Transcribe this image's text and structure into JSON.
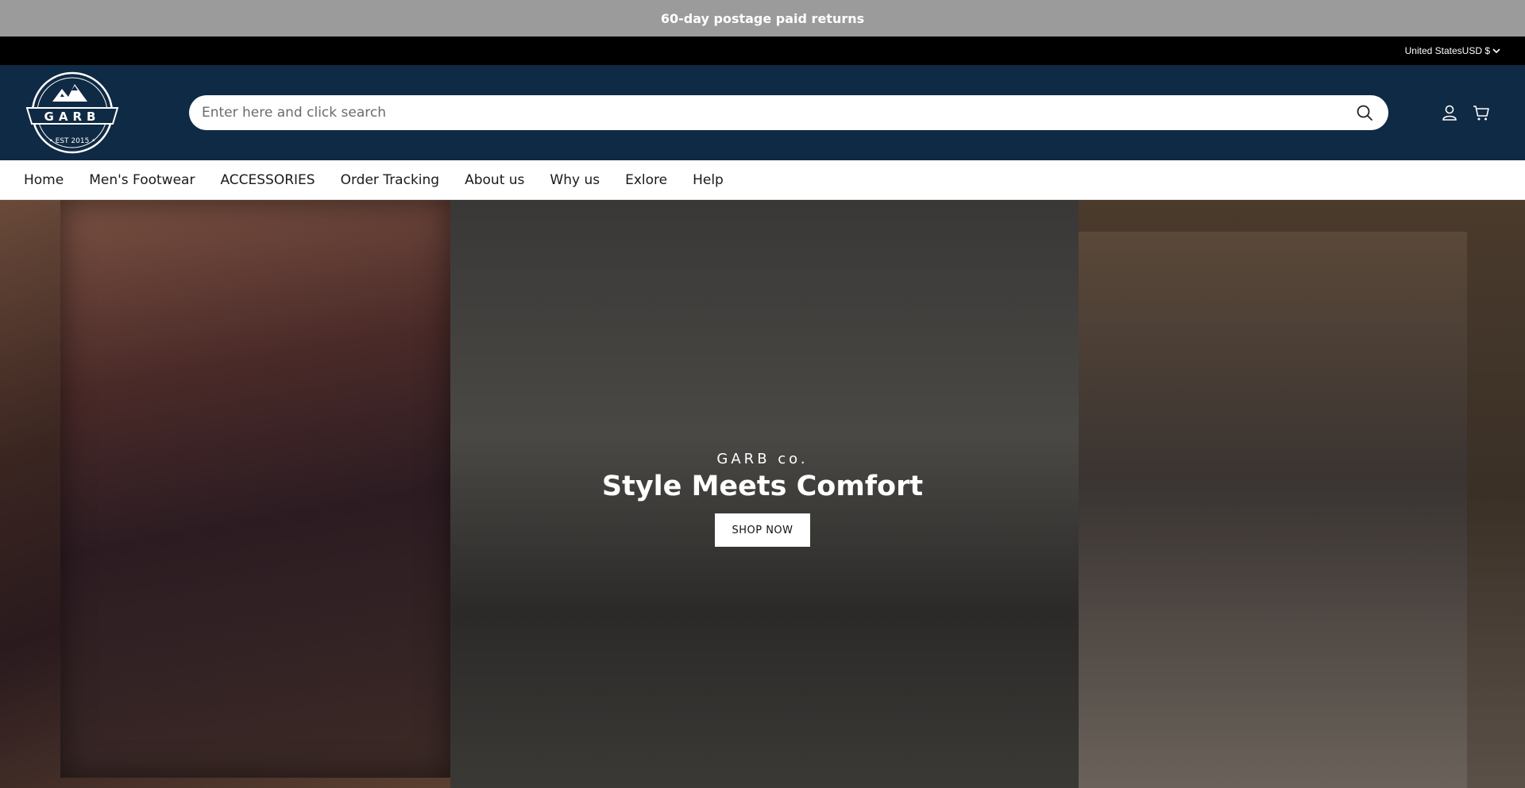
{
  "announcement": {
    "text": "60-day postage paid returns"
  },
  "utility": {
    "country": "United States",
    "currency": "USD $"
  },
  "header": {
    "logo": {
      "brand": "GARB",
      "tagline": "EST 2015"
    },
    "search": {
      "placeholder": "Enter here and click search"
    },
    "icons": [
      "search-icon",
      "account-icon",
      "cart-icon"
    ]
  },
  "nav": {
    "items": [
      "Home",
      "Men's Footwear",
      "ACCESSORIES",
      "Order Tracking",
      "About us",
      "Why us",
      "Exlore",
      "Help"
    ]
  },
  "hero": {
    "eyebrow": "GARB co.",
    "headline": "Style Meets Comfort",
    "cta_label": "SHOP NOW"
  },
  "colors": {
    "announcement_bg": "#9b9b9b",
    "utility_bg": "#000000",
    "header_bg": "#0f2a44"
  }
}
